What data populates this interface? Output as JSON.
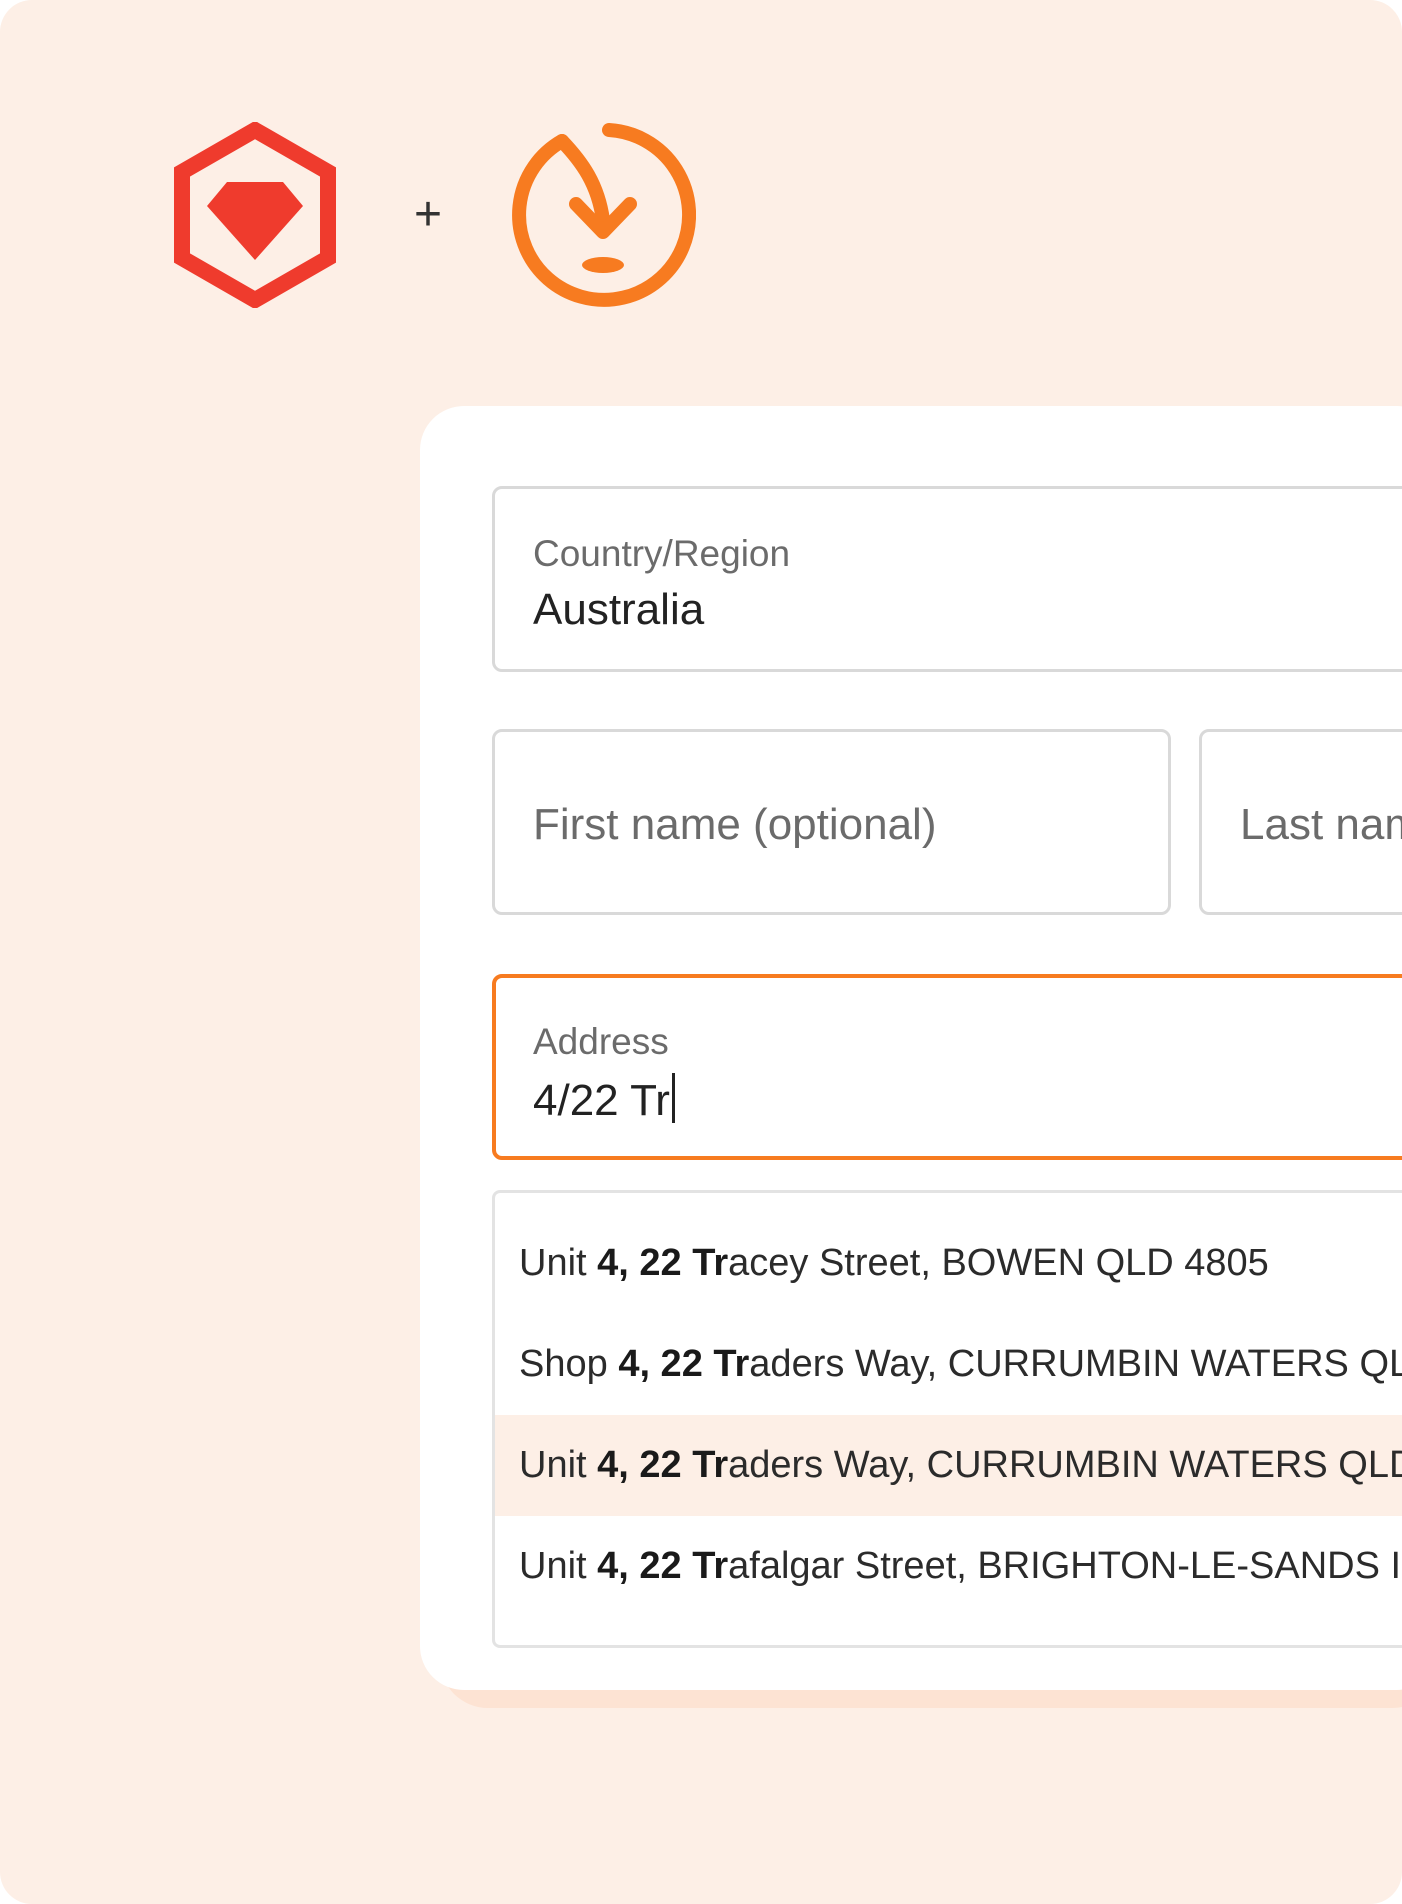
{
  "colors": {
    "background": "#fdefe6",
    "ruby_red": "#ef3b2d",
    "brand_orange": "#f77b20",
    "active_suggestion": "#fdefe6"
  },
  "header": {
    "logo_left_icon": "ruby-hexagon-logo",
    "separator": "+",
    "logo_right_icon": "circular-arrow-download-logo"
  },
  "form": {
    "country": {
      "label": "Country/Region",
      "value": "Australia"
    },
    "first_name": {
      "placeholder": "First name (optional)"
    },
    "last_name": {
      "placeholder": "Last nam"
    },
    "address": {
      "label": "Address",
      "value": "4/22 Tr"
    }
  },
  "suggestions": [
    {
      "prefix": "Unit ",
      "match": "4, 22 Tr",
      "suffix": "acey Street, BOWEN QLD 4805",
      "active": false
    },
    {
      "prefix": "Shop ",
      "match": "4, 22 Tr",
      "suffix": "aders Way, CURRUMBIN WATERS QLI",
      "active": false
    },
    {
      "prefix": "Unit ",
      "match": "4, 22 Tr",
      "suffix": "aders Way, CURRUMBIN WATERS QLD",
      "active": true
    },
    {
      "prefix": "Unit ",
      "match": "4, 22 Tr",
      "suffix": "afalgar Street, BRIGHTON-LE-SANDS I",
      "active": false
    }
  ]
}
